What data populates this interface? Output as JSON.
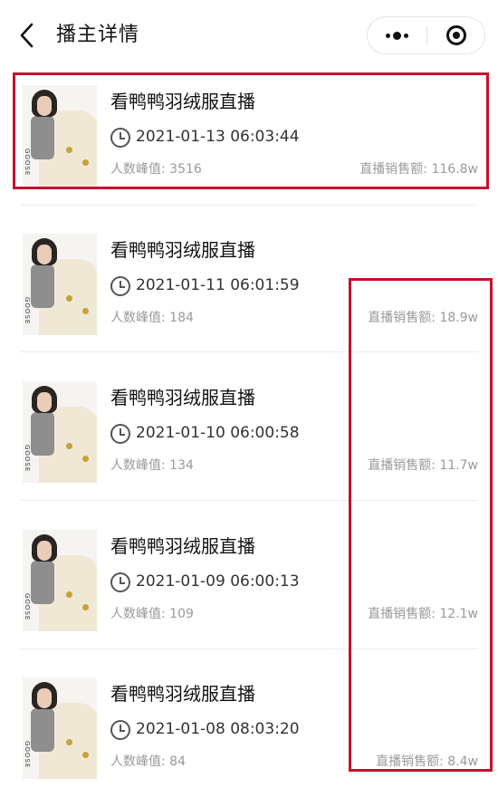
{
  "nav": {
    "title": "播主详情",
    "back_icon": "chevron-left-icon",
    "more_icon": "more-dots-icon",
    "close_icon": "target-close-icon"
  },
  "broadcast_list": [
    {
      "title": "看鸭鸭羽绒服直播",
      "time": "2021-01-13 06:03:44",
      "peak_label": "人数峰值: ",
      "peak_value": "3516",
      "sales_label": "直播销售额: ",
      "sales_value": "116.8w",
      "highlighted": true
    },
    {
      "title": "看鸭鸭羽绒服直播",
      "time": "2021-01-11 06:01:59",
      "peak_label": "人数峰值: ",
      "peak_value": "184",
      "sales_label": "直播销售额: ",
      "sales_value": "18.9w"
    },
    {
      "title": "看鸭鸭羽绒服直播",
      "time": "2021-01-10 06:00:58",
      "peak_label": "人数峰值: ",
      "peak_value": "134",
      "sales_label": "直播销售额: ",
      "sales_value": "11.7w"
    },
    {
      "title": "看鸭鸭羽绒服直播",
      "time": "2021-01-09 06:00:13",
      "peak_label": "人数峰值: ",
      "peak_value": "109",
      "sales_label": "直播销售额: ",
      "sales_value": "12.1w"
    },
    {
      "title": "看鸭鸭羽绒服直播",
      "time": "2021-01-08 08:03:20",
      "peak_label": "人数峰值: ",
      "peak_value": "84",
      "sales_label": "直播销售额: ",
      "sales_value": "8.4w"
    }
  ],
  "thumbnail_brand_text": "GOOSE",
  "colors": {
    "highlight_border": "#c8102e",
    "muted_text": "#9a9a9a",
    "divider": "#ececec"
  }
}
